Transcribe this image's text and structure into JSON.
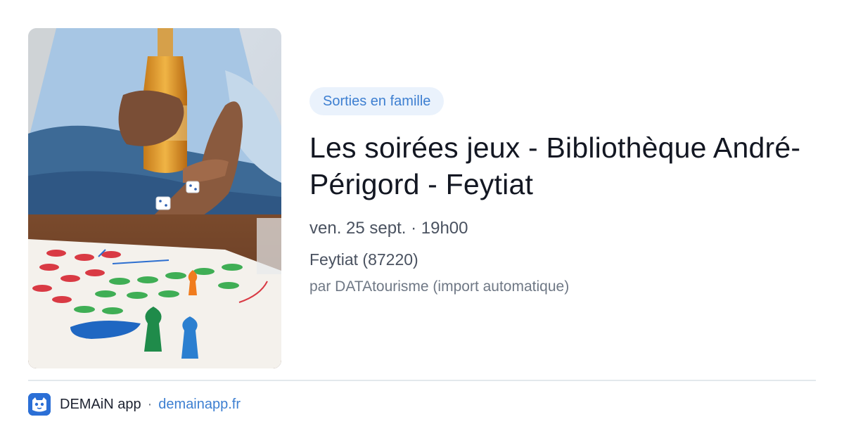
{
  "event": {
    "category": "Sorties en famille",
    "title": "Les soirées jeux - Bibliothèque André-Périgord - Feytiat",
    "datetime": "ven. 25 sept. · 19h00",
    "location": "Feytiat (87220)",
    "source": "par DATAtourisme (import automatique)",
    "image": {
      "icon": "board-game-photo"
    }
  },
  "footer": {
    "app_name": "DEMAiN app",
    "separator": "·",
    "link": "demainapp.fr",
    "logo_icon": "demain-app-logo-icon"
  },
  "colors": {
    "accent": "#3d7fd1",
    "pill_background": "#eaf2fc",
    "title_text": "#131722",
    "divider": "#e3e8ec"
  }
}
